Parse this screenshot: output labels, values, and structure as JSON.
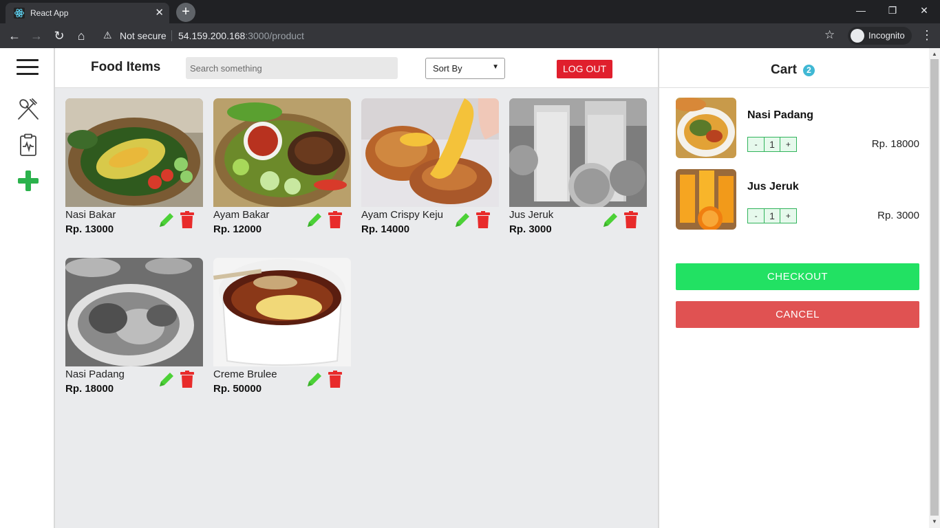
{
  "browser": {
    "tab_title": "React App",
    "url_host": "54.159.200.168",
    "url_path": ":3000/product",
    "security_label": "Not secure",
    "profile_label": "Incognito"
  },
  "header": {
    "title": "Food Items",
    "search_placeholder": "Search something",
    "sort_label": "Sort By",
    "logout_label": "LOG OUT"
  },
  "products": [
    {
      "name": "Nasi Bakar",
      "price": "Rp. 13000"
    },
    {
      "name": "Ayam Bakar",
      "price": "Rp. 12000"
    },
    {
      "name": "Ayam Crispy Keju",
      "price": "Rp. 14000"
    },
    {
      "name": "Jus Jeruk",
      "price": "Rp. 3000"
    },
    {
      "name": "Nasi Padang",
      "price": "Rp. 18000"
    },
    {
      "name": "Creme Brulee",
      "price": "Rp. 50000"
    }
  ],
  "cart": {
    "title": "Cart",
    "count": "2",
    "items": [
      {
        "name": "Nasi Padang",
        "qty": "1",
        "price": "Rp. 18000",
        "minus": "-",
        "plus": "+"
      },
      {
        "name": "Jus Jeruk",
        "qty": "1",
        "price": "Rp. 3000",
        "minus": "-",
        "plus": "+"
      }
    ],
    "checkout_label": "CHECKOUT",
    "cancel_label": "CANCEL"
  },
  "colors": {
    "logout": "#e01f2d",
    "checkout": "#22e163",
    "cancel": "#e05252",
    "edit_icon": "#4cd137",
    "delete_icon": "#e82b2b",
    "badge": "#40b8d4"
  }
}
